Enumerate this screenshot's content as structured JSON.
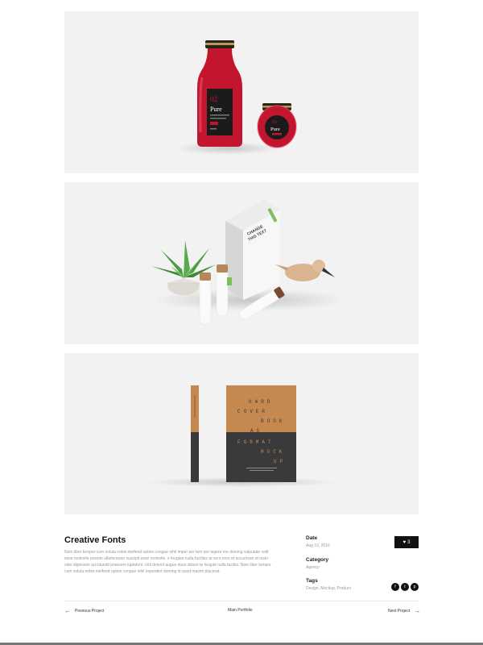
{
  "gallery": {
    "bottle_label_number": "02",
    "bottle_label_brand": "Pure",
    "jar_label_number": "05",
    "jar_label_brand": "Pure",
    "bag_label_line1": "CHANGE",
    "bag_label_line2": "THIS TEXT",
    "book_cover_lines": [
      "HARD",
      "COVER",
      "BOOK",
      "AS",
      "FORMAT",
      "MOCK",
      "UP"
    ]
  },
  "project": {
    "title": "Creative Fonts",
    "description": "Nam liber tempor cum soluta nobis eleifend option congue nihil imper per tem por legere me doming vulputate velit esse molestie possim ullamcorper suscipit esse molestie. s feugian nulla facilisis at vero eros et accumsan et iusto odio dignissim qui blandit praesent luptatum. ctril delenit augue duos dolore te feugait nulla facilisi. Nam liber tempor cum soluta nobis eleifend option congue nihil imperdiet doming id quod mazim placerat."
  },
  "meta": {
    "date_label": "Date",
    "date_value": "Aug 10, 2016",
    "category_label": "Category",
    "category_value": "Agency",
    "tags_label": "Tags",
    "tags_value": "Design, Mockup, Product"
  },
  "like": {
    "icon": "heart-icon",
    "count": "3"
  },
  "share": [
    {
      "name": "facebook-icon",
      "glyph": "f"
    },
    {
      "name": "twitter-icon",
      "glyph": "t"
    },
    {
      "name": "pinterest-icon",
      "glyph": "p"
    }
  ],
  "navigation": {
    "previous": "Previous Project",
    "main": "Main Portfolio",
    "next": "Next Project"
  },
  "colors": {
    "accent_red": "#c4152e",
    "book_orange": "#c5894f",
    "book_dark": "#3a3a3c",
    "dark_button": "#111111"
  }
}
